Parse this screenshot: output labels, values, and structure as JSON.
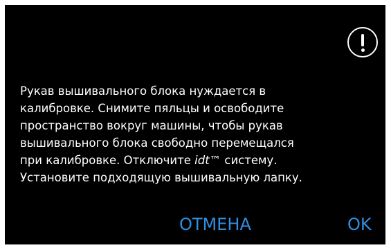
{
  "alert": {
    "icon": "exclamation-circle-icon",
    "message_lines": [
      {
        "text": "Рукав вышивального блока нуждается в"
      },
      {
        "text": "калибровке. Снимите пяльцы и освободите"
      },
      {
        "text": "пространство вокруг машины, чтобы рукав"
      },
      {
        "text": "вышивального блока свободно перемещался"
      },
      {
        "before": "при калибровке. Отключите ",
        "italic": "idt",
        "after": "™ систему."
      },
      {
        "text": "Установите подходящую вышивальную лапку."
      }
    ]
  },
  "buttons": {
    "cancel_label": "ОТМЕНА",
    "ok_label": "OK"
  },
  "colors": {
    "background": "#000000",
    "text": "#ffffff",
    "accent": "#2f8fe0"
  }
}
